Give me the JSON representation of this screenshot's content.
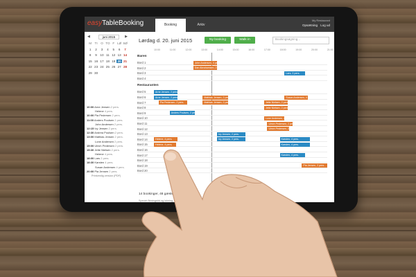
{
  "app": {
    "logo_easy": "easy",
    "logo_rest": "TableBooking"
  },
  "tabs": [
    {
      "label": "Booking"
    },
    {
      "label": "Arkiv"
    }
  ],
  "user": {
    "name": "My Restaurant",
    "links": [
      "Opsætning",
      "Log ud"
    ]
  },
  "calendar": {
    "month_label": "juni 2015",
    "day_headers": [
      "M",
      "TI",
      "O",
      "TO",
      "F",
      "LØ",
      "SØ"
    ],
    "days": [
      "1",
      "2",
      "3",
      "4",
      "5",
      "6",
      "7",
      "8",
      "9",
      "10",
      "11",
      "12",
      "13",
      "14",
      "15",
      "16",
      "17",
      "18",
      "19",
      "20",
      "21",
      "22",
      "23",
      "24",
      "25",
      "26",
      "27",
      "28",
      "29",
      "30"
    ],
    "selected_day": "20"
  },
  "booking_list": [
    {
      "time": "10:00",
      "name": "Arne Jensen",
      "persons": "2 pers."
    },
    {
      "time": "",
      "name": "Helene",
      "persons": "4 pers."
    },
    {
      "time": "10:00",
      "name": "Pia Pedersen",
      "persons": "2 pers."
    },
    {
      "time": "11:00",
      "name": "Anders Poulsen",
      "persons": "2 pers."
    },
    {
      "time": "",
      "name": "John Andersen",
      "persons": "2 pers."
    },
    {
      "time": "12:15",
      "name": "Ivy Jensen",
      "persons": "2 pers."
    },
    {
      "time": "12:30",
      "name": "Andrea Poulsen",
      "persons": "2 pers."
    },
    {
      "time": "13:00",
      "name": "Mathias Jensen",
      "persons": "2 pers."
    },
    {
      "time": "",
      "name": "Lone Andersen",
      "persons": "2 pers."
    },
    {
      "time": "15:00",
      "name": "Ulrich Pedersen",
      "persons": "2 pers."
    },
    {
      "time": "15:30",
      "name": "Jette Nielsen",
      "persons": "2 pers."
    },
    {
      "time": "",
      "name": "Helene",
      "persons": "4 pers."
    },
    {
      "time": "18:00",
      "name": "Lars",
      "persons": "2 pers."
    },
    {
      "time": "18:30",
      "name": "Karsten",
      "persons": "4 pers."
    },
    {
      "time": "",
      "name": "Susan Andersen",
      "persons": "4 pers."
    },
    {
      "time": "20:00",
      "name": "Pia Jensen",
      "persons": "2 pers."
    }
  ],
  "print_link": "Printvenlig version (PDF)",
  "main": {
    "date_title": "Lørdag d. 20. juni 2015",
    "new_booking": "Ny booking",
    "walk_in": "Walk in",
    "search_placeholder": "Bookingsøgning...",
    "hours": [
      "10:00",
      "11:00",
      "12:00",
      "13:00",
      "14:00",
      "15:00",
      "16:00",
      "17:00",
      "18:00",
      "19:00",
      "20:00",
      "21:00"
    ],
    "sections": [
      {
        "label": "Baren",
        "tables": [
          "Bord 1",
          "Bord 2",
          "Bord 3",
          "Bord 4"
        ]
      },
      {
        "label": "Restauranten",
        "tables": [
          "Bord 5",
          "Bord 6",
          "Bord 7",
          "Bord 8",
          "Bord 9",
          "Bord 10",
          "Bord 11",
          "Bord 12",
          "Bord 13",
          "Bord 14",
          "Bord 15",
          "Bord 16",
          "Bord 17",
          "Bord 18",
          "Bord 19",
          "Bord 20"
        ]
      }
    ],
    "bookings": [
      {
        "row": 0,
        "start": 2.5,
        "dur": 1.5,
        "color": "or",
        "label": "John Andersen, 4 pers."
      },
      {
        "row": 1,
        "start": 2.5,
        "dur": 1.5,
        "color": "or",
        "label": "Dan Abrahamsen, 2 pers."
      },
      {
        "row": 2,
        "start": 8.3,
        "dur": 1.3,
        "color": "bl",
        "label": "Lars, 2 pers."
      },
      {
        "row": 4,
        "start": 0.0,
        "dur": 1.5,
        "color": "bl",
        "label": "Arne Jensen, 2 pers."
      },
      {
        "row": 5,
        "start": 0.0,
        "dur": 1.5,
        "color": "bl",
        "label": "Arne Jensen, 2 pers."
      },
      {
        "row": 5,
        "start": 3.1,
        "dur": 1.6,
        "color": "or",
        "label": "Mathias Jensen, 2 pers."
      },
      {
        "row": 5,
        "start": 8.3,
        "dur": 1.5,
        "color": "or",
        "label": "Susan Andersen, 4 pers."
      },
      {
        "row": 6,
        "start": 0.3,
        "dur": 1.8,
        "color": "or",
        "label": "Pia Pedersen, 2 pers."
      },
      {
        "row": 6,
        "start": 3.1,
        "dur": 1.6,
        "color": "or",
        "label": "Mathias Jensen, 2 pers."
      },
      {
        "row": 6,
        "start": 7.0,
        "dur": 1.5,
        "color": "or",
        "label": "Jette Nielsen, 2 pers."
      },
      {
        "row": 7,
        "start": 7.0,
        "dur": 1.5,
        "color": "or",
        "label": "Jette Nielsen, 2 pers."
      },
      {
        "row": 8,
        "start": 1.0,
        "dur": 1.6,
        "color": "bl",
        "label": "Anders Poulsen, 2 pers."
      },
      {
        "row": 9,
        "start": 7.0,
        "dur": 1.3,
        "color": "or",
        "label": "Lone Andersen, 2 pers."
      },
      {
        "row": 10,
        "start": 7.2,
        "dur": 1.6,
        "color": "or",
        "label": "Ulrich Pedersen, 2 pers."
      },
      {
        "row": 11,
        "start": 7.2,
        "dur": 1.4,
        "color": "or",
        "label": "Ulrich Pedersen, 2 pers."
      },
      {
        "row": 12,
        "start": 4.0,
        "dur": 1.8,
        "color": "bl",
        "label": "Ivy Jensen, 2 pers."
      },
      {
        "row": 13,
        "start": 0.0,
        "dur": 1.5,
        "color": "or",
        "label": "Helene, 4 pers."
      },
      {
        "row": 13,
        "start": 4.0,
        "dur": 1.8,
        "color": "bl",
        "label": "Ivy Jensen, 2 pers."
      },
      {
        "row": 13,
        "start": 8.0,
        "dur": 1.9,
        "color": "bl",
        "label": "Karsten, 4 pers."
      },
      {
        "row": 14,
        "start": 0.0,
        "dur": 1.4,
        "color": "or",
        "label": "Helene, 4 pers."
      },
      {
        "row": 14,
        "start": 8.0,
        "dur": 1.9,
        "color": "bl",
        "label": "Karsten, 4 pers."
      },
      {
        "row": 16,
        "start": 8.0,
        "dur": 1.6,
        "color": "bl",
        "label": "Karsten, 4 pers."
      },
      {
        "row": 18,
        "start": 9.4,
        "dur": 1.6,
        "color": "or",
        "label": "Pia Jensen, 2 pers."
      }
    ],
    "footer_count": "14 bookinger, 48 gæster",
    "footer_note": "Speciel åbningstid og lukning"
  },
  "colors": {
    "accent_green": "#4fae4a",
    "booking_orange": "#e27a2f",
    "booking_blue": "#2a8ac4",
    "selected_day": "#2a7fb8"
  }
}
